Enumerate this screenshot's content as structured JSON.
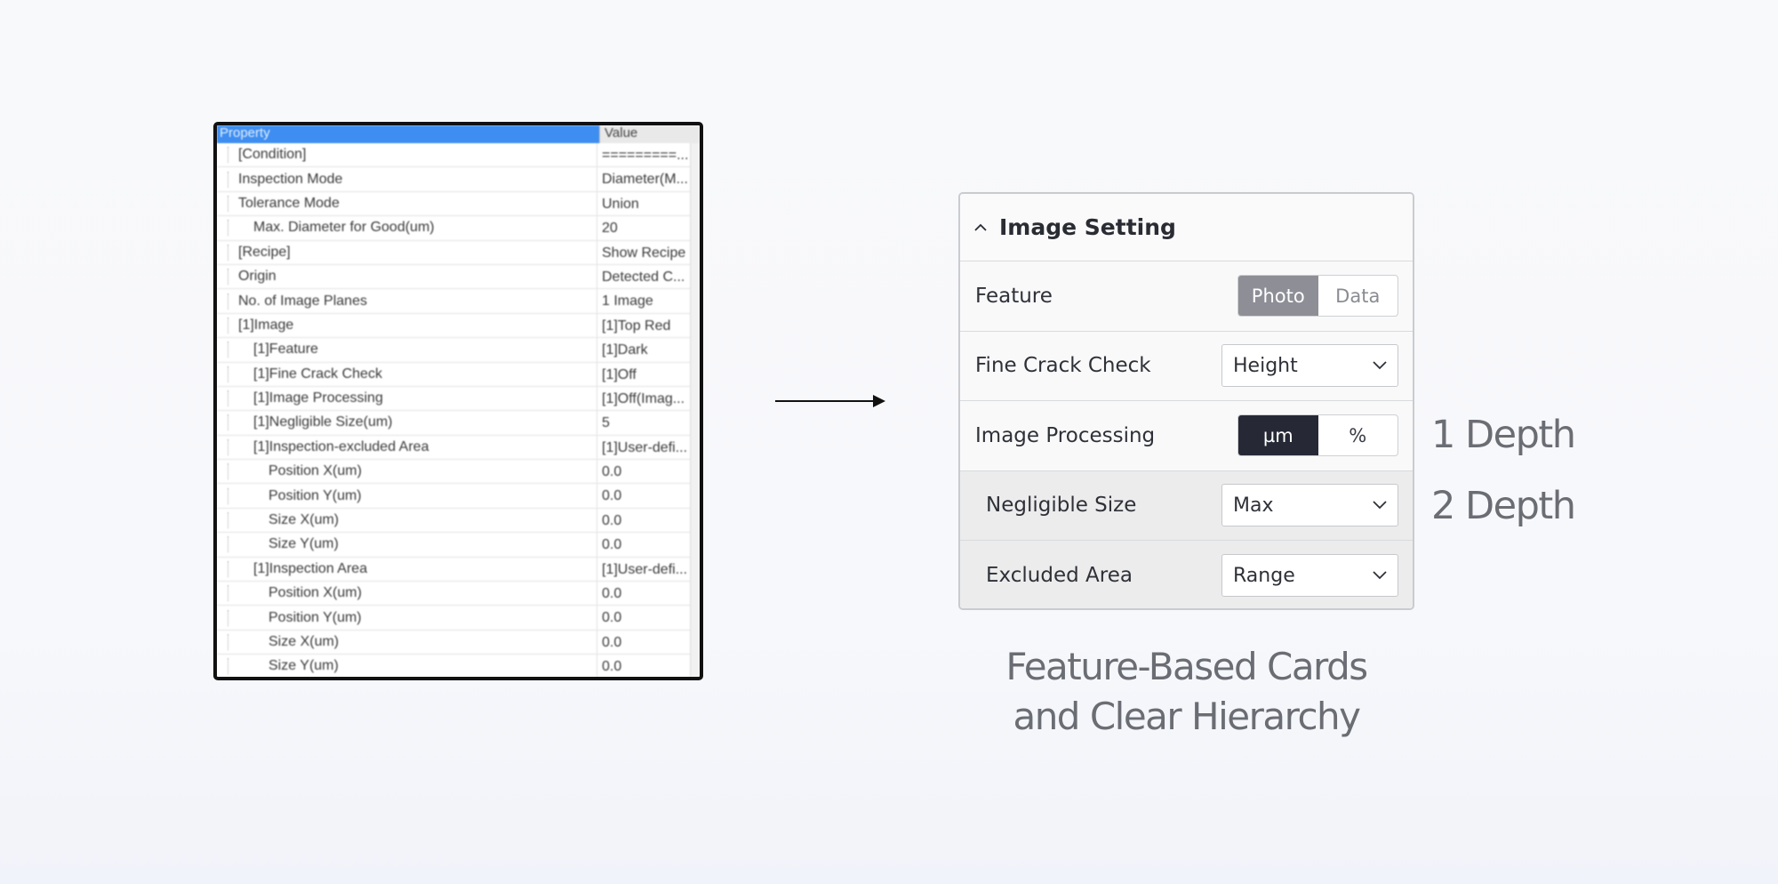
{
  "legacy": {
    "header": {
      "property": "Property",
      "value": "Value"
    },
    "rows": [
      {
        "name": "[Condition]",
        "value": "=========...",
        "depth": 0
      },
      {
        "name": "Inspection Mode",
        "value": "Diameter(M...",
        "depth": 0
      },
      {
        "name": "Tolerance Mode",
        "value": "Union",
        "depth": 0
      },
      {
        "name": "Max. Diameter for Good(um)",
        "value": "20",
        "depth": 1
      },
      {
        "name": "[Recipe]",
        "value": "Show Recipe",
        "depth": 0
      },
      {
        "name": "Origin",
        "value": "Detected C...",
        "depth": 0
      },
      {
        "name": "No. of Image Planes",
        "value": "1 Image",
        "depth": 0
      },
      {
        "name": "[1]Image",
        "value": "[1]Top Red",
        "depth": 0
      },
      {
        "name": "[1]Feature",
        "value": "[1]Dark",
        "depth": 1
      },
      {
        "name": "[1]Fine Crack Check",
        "value": "[1]Off",
        "depth": 1
      },
      {
        "name": "[1]Image Processing",
        "value": "[1]Off(Imag...",
        "depth": 1
      },
      {
        "name": "[1]Negligible Size(um)",
        "value": "5",
        "depth": 1
      },
      {
        "name": "[1]Inspection-excluded Area",
        "value": "[1]User-defi...",
        "depth": 1
      },
      {
        "name": "Position X(um)",
        "value": "0.0",
        "depth": 2
      },
      {
        "name": "Position Y(um)",
        "value": "0.0",
        "depth": 2
      },
      {
        "name": "Size X(um)",
        "value": "0.0",
        "depth": 2
      },
      {
        "name": "Size Y(um)",
        "value": "0.0",
        "depth": 2
      },
      {
        "name": "[1]Inspection Area",
        "value": "[1]User-defi...",
        "depth": 1
      },
      {
        "name": "Position X(um)",
        "value": "0.0",
        "depth": 2
      },
      {
        "name": "Position Y(um)",
        "value": "0.0",
        "depth": 2
      },
      {
        "name": "Size X(um)",
        "value": "0.0",
        "depth": 2
      },
      {
        "name": "Size Y(um)",
        "value": "0.0",
        "depth": 2
      }
    ]
  },
  "card": {
    "title": "Image Setting",
    "feature": {
      "label": "Feature",
      "options": [
        "Photo",
        "Data"
      ],
      "selected": "Photo"
    },
    "fine_crack": {
      "label": "Fine Crack Check",
      "value": "Height"
    },
    "image_processing": {
      "label": "Image Processing",
      "options": [
        "µm",
        "%"
      ],
      "selected": "µm"
    },
    "negligible": {
      "label": "Negligible Size",
      "value": "Max"
    },
    "excluded": {
      "label": "Excluded Area",
      "value": "Range"
    }
  },
  "depth_labels": {
    "one": "1 Depth",
    "two": "2 Depth"
  },
  "caption": {
    "line1": "Feature-Based Cards",
    "line2": "and Clear Hierarchy"
  },
  "colors": {
    "legacy_header": "#3d8ef0",
    "seg_active_grey": "#8d8e96",
    "seg_active_dark": "#262935",
    "caption": "#6b6d74"
  },
  "icons": {
    "collapse": "chevron-up-icon",
    "dropdown": "chevron-down-icon",
    "arrow": "arrow-right-icon"
  }
}
